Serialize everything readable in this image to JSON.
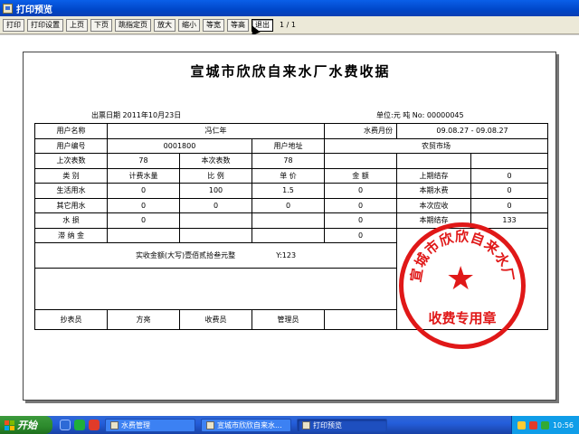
{
  "window": {
    "title": "打印预览"
  },
  "toolbar": {
    "buttons": [
      "打印",
      "打印设置",
      "上页",
      "下页",
      "跳指定页",
      "放大",
      "缩小",
      "等宽",
      "等高",
      "退出"
    ],
    "page_info": "1 / 1"
  },
  "receipt": {
    "title": "宣城市欣欣自来水厂水费收据",
    "issue_date": "出票日期  2011年10月23日",
    "unit_info": "单位:元  吨    No:  00000045",
    "rows": {
      "user_name_label": "用户名称",
      "user_name": "冯仁年",
      "period_label": "水费月份",
      "period": "09.08.27 - 09.08.27",
      "user_no_label": "用户编号",
      "user_no": "0001800",
      "address_label": "用户地址",
      "address": "农贸市场",
      "last_reading_label": "上次表数",
      "last_reading": "78",
      "current_reading_label": "本次表数",
      "current_reading": "78",
      "col_category": "类    别",
      "col_volume": "计费水量",
      "col_ratio": "比    例",
      "col_price": "单    价",
      "col_amount": "金    额",
      "prev_balance_label": "上期结存",
      "prev_balance": "0",
      "r1_label": "生活用水",
      "r1_volume": "0",
      "r1_ratio": "100",
      "r1_price": "1.5",
      "r1_amount": "0",
      "period_fee_label": "本期水费",
      "period_fee": "0",
      "r2_label": "其它用水",
      "r2_volume": "0",
      "r2_ratio": "0",
      "r2_price": "0",
      "r2_amount": "0",
      "due_label": "本次应收",
      "due": "0",
      "r3_label": "水    损",
      "r3_volume": "0",
      "r3_amount": "0",
      "curr_balance_label": "本期结存",
      "curr_balance": "133",
      "late_fee_label": "滞 纳 金",
      "late_fee_amount": "0",
      "total_words": "实收金额(大写)壹佰贰拾叁元整",
      "total_num": "Y:123",
      "meter_reader_label": "抄表员",
      "meter_reader": "方亮",
      "cashier_label": "收费员",
      "manager_label": "管理员"
    },
    "stamp": {
      "top_text": "宣城市欣欣自来水厂",
      "bottom_text": "收费专用章",
      "color": "#e01818"
    }
  },
  "taskbar": {
    "start_label": "开始",
    "tasks": [
      "水费管理",
      "宣城市欣欣自来水...",
      "打印预览"
    ],
    "clock": "10:56"
  }
}
